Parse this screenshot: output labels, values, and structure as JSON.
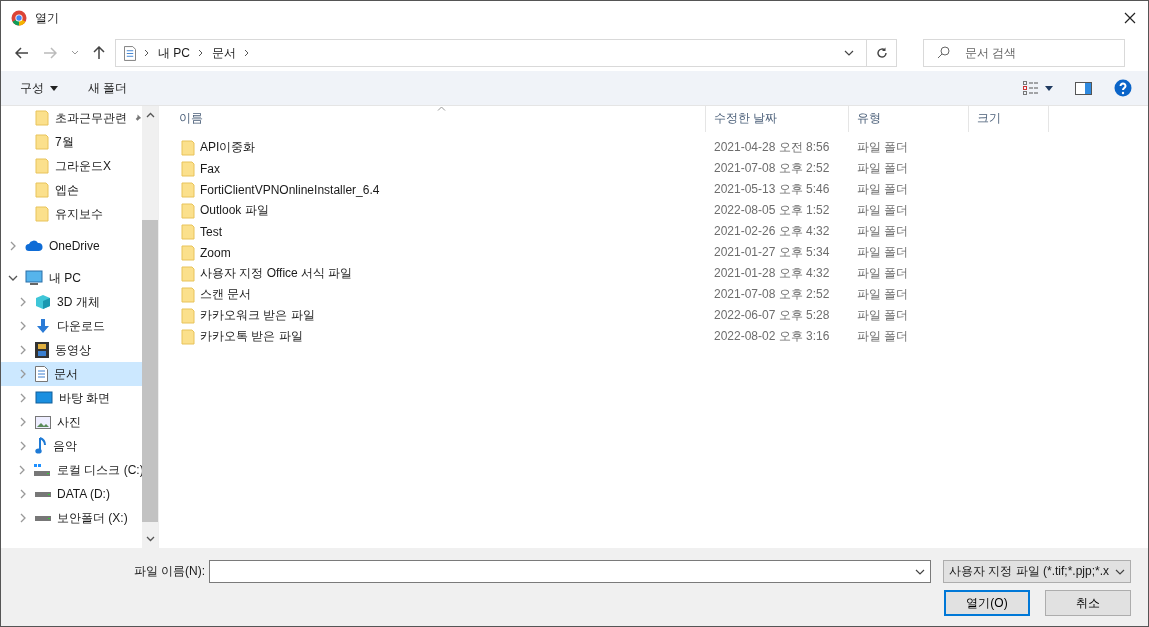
{
  "window": {
    "title": "열기"
  },
  "address": {
    "crumbs": [
      "내 PC",
      "문서"
    ]
  },
  "search": {
    "placeholder": "문서 검색"
  },
  "toolbar": {
    "organize": "구성",
    "new_folder": "새 폴더"
  },
  "quick_access": [
    {
      "label": "초과근무관련",
      "pinned": true
    },
    {
      "label": "7월",
      "pinned": false
    },
    {
      "label": "그라운드X",
      "pinned": false
    },
    {
      "label": "엡손",
      "pinned": false
    },
    {
      "label": "유지보수",
      "pinned": false
    }
  ],
  "tree": [
    {
      "label": "OneDrive",
      "kind": "cloud",
      "expanded": false,
      "selected": false
    },
    {
      "label": "내 PC",
      "kind": "computer",
      "expanded": true,
      "selected": false,
      "children": [
        {
          "label": "3D 개체",
          "kind": "cube",
          "expanded": false,
          "selected": false
        },
        {
          "label": "다운로드",
          "kind": "download",
          "expanded": false,
          "selected": false
        },
        {
          "label": "동영상",
          "kind": "video",
          "expanded": false,
          "selected": false
        },
        {
          "label": "문서",
          "kind": "document",
          "expanded": false,
          "selected": true
        },
        {
          "label": "바탕 화면",
          "kind": "desktop",
          "expanded": false,
          "selected": false
        },
        {
          "label": "사진",
          "kind": "picture",
          "expanded": false,
          "selected": false
        },
        {
          "label": "음악",
          "kind": "music",
          "expanded": false,
          "selected": false
        },
        {
          "label": "로컬 디스크 (C:)",
          "kind": "system-drive",
          "expanded": false,
          "selected": false
        },
        {
          "label": "DATA (D:)",
          "kind": "drive",
          "expanded": false,
          "selected": false
        },
        {
          "label": "보안폴더 (X:)",
          "kind": "drive",
          "expanded": false,
          "selected": false
        }
      ]
    }
  ],
  "table": {
    "columns": [
      "이름",
      "수정한 날짜",
      "유형",
      "크기"
    ],
    "rows": [
      [
        "API이중화",
        "2021-04-28 오전 8:56",
        "파일 폴더"
      ],
      [
        "Fax",
        "2021-07-08 오후 2:52",
        "파일 폴더"
      ],
      [
        "FortiClientVPNOnlineInstaller_6.4",
        "2021-05-13 오후 5:46",
        "파일 폴더"
      ],
      [
        "Outlook 파일",
        "2022-08-05 오후 1:52",
        "파일 폴더"
      ],
      [
        "Test",
        "2021-02-26 오후 4:32",
        "파일 폴더"
      ],
      [
        "Zoom",
        "2021-01-27 오후 5:34",
        "파일 폴더"
      ],
      [
        "사용자 지정 Office 서식 파일",
        "2021-01-28 오후 4:32",
        "파일 폴더"
      ],
      [
        "스캔 문서",
        "2021-07-08 오후 2:52",
        "파일 폴더"
      ],
      [
        "카카오워크 받은 파일",
        "2022-06-07 오후 5:28",
        "파일 폴더"
      ],
      [
        "카카오톡 받은 파일",
        "2022-08-02 오후 3:16",
        "파일 폴더"
      ]
    ]
  },
  "footer": {
    "filename_label": "파일 이름(N):",
    "filter": "사용자 지정 파일 (*.tif;*.pjp;*.x",
    "buttons": [
      "열기(O)",
      "취소"
    ]
  }
}
